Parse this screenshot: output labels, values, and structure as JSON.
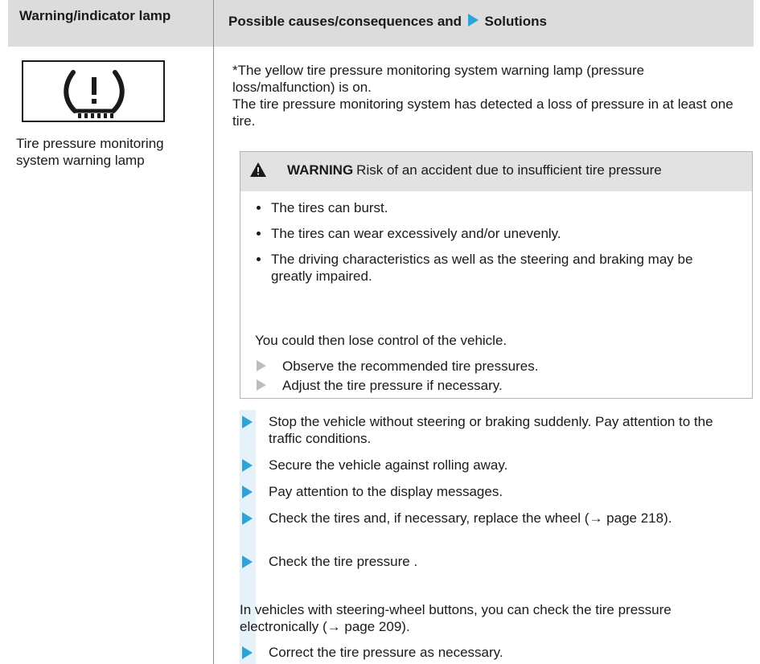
{
  "header": {
    "col1": "Warning/indicator lamp",
    "col2_prefix": "Possible causes/consequences and",
    "col2_suffix": "Solutions"
  },
  "lamp": {
    "icon": "tire-pressure-warning-icon",
    "caption": "Tire pressure monitoring system warning lamp"
  },
  "intro": {
    "line1": "*The yellow tire pressure monitoring system warning lamp (pressure loss/malfunction) is on.",
    "line2": "The tire pressure monitoring system has detected a loss of pressure in at least one tire."
  },
  "warning": {
    "keyword": "WARNING",
    "title": "Risk of an accident due to insufficient tire pressure",
    "bullets": [
      "The tires can burst.",
      "The tires can wear excessively and/or unevenly.",
      "The driving characteristics as well as the steering and braking may be greatly impaired."
    ],
    "conclusion": "You could then lose control of the vehicle.",
    "steps": [
      "Observe the recommended tire pressures.",
      "Adjust the tire pressure if necessary."
    ]
  },
  "solutions": {
    "steps": [
      "Stop the vehicle without steering or braking suddenly. Pay attention to the traffic conditions.",
      "Secure the vehicle against rolling away.",
      "Pay attention to the display messages.",
      "Check the tires and, if necessary, replace the wheel (→ page 218).",
      "Check the tire pressure ."
    ],
    "electronic_note": "In vehicles with steering-wheel buttons, you can check the tire pressure electronically (→ page 209).",
    "final_step": "Correct the tire pressure as necessary."
  },
  "colors": {
    "accent": "#2ba5d8",
    "header_bg": "#dcdcdc",
    "warning_bg": "#e2e2e2"
  }
}
